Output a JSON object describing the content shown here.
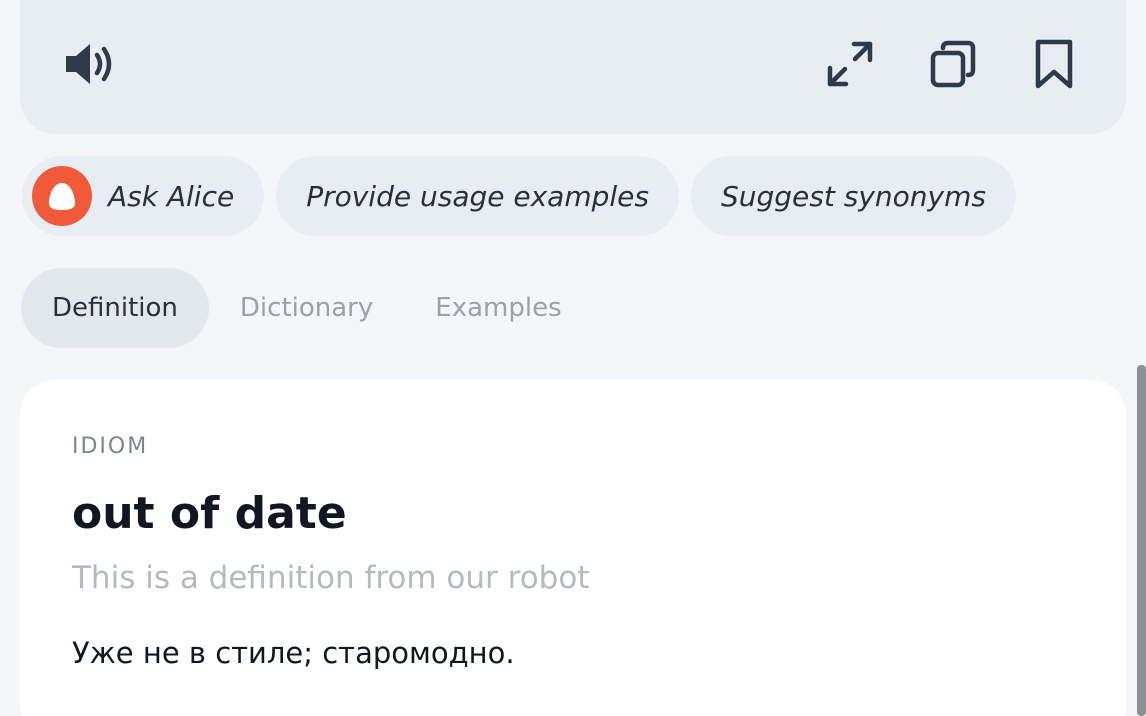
{
  "toolbar": {
    "speaker_icon": "speaker-icon",
    "expand_icon": "expand-icon",
    "copy_icon": "copy-icon",
    "bookmark_icon": "bookmark-icon"
  },
  "chips": {
    "ask_alice": "Ask Alice",
    "usage_examples": "Provide usage examples",
    "suggest_synonyms": "Suggest synonyms"
  },
  "tabs": {
    "definition": "Definition",
    "dictionary": "Dictionary",
    "examples": "Examples",
    "active": "Definition"
  },
  "card": {
    "part_of_speech": "IDIOM",
    "headword": "out of date",
    "note": "This is a definition from our robot",
    "definition": "Уже не в стиле; старомодно."
  },
  "colors": {
    "alice_brand": "#f05a3a",
    "panel_bg": "#e8edf4",
    "page_bg": "#f4f6f9"
  }
}
